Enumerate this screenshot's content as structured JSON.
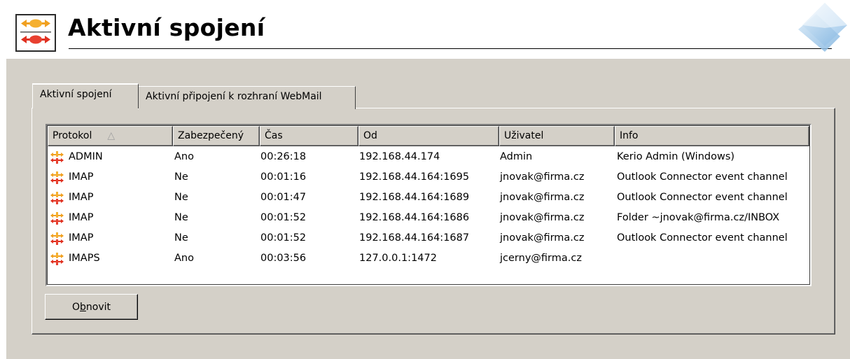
{
  "header": {
    "title": "Aktivní spojení",
    "icon": "connections-icon"
  },
  "tabs": [
    {
      "label": "Aktivní spojení",
      "active": true
    },
    {
      "label": "Aktivní připojení k rozhraní WebMail",
      "active": false
    }
  ],
  "table": {
    "columns": [
      "Protokol",
      "Zabezpečený",
      "Čas",
      "Od",
      "Uživatel",
      "Info"
    ],
    "sort": {
      "column": "Protokol",
      "direction": "ascending"
    },
    "rows": [
      [
        "ADMIN",
        "Ano",
        "00:26:18",
        "192.168.44.174",
        "Admin",
        "Kerio Admin (Windows)"
      ],
      [
        "IMAP",
        "Ne",
        "00:01:16",
        "192.168.44.164:1695",
        "jnovak@firma.cz",
        "Outlook Connector event channel"
      ],
      [
        "IMAP",
        "Ne",
        "00:01:47",
        "192.168.44.164:1689",
        "jnovak@firma.cz",
        "Outlook Connector event channel"
      ],
      [
        "IMAP",
        "Ne",
        "00:01:52",
        "192.168.44.164:1686",
        "jnovak@firma.cz",
        "Folder ~jnovak@firma.cz/INBOX"
      ],
      [
        "IMAP",
        "Ne",
        "00:01:52",
        "192.168.44.164:1687",
        "jnovak@firma.cz",
        "Outlook Connector event channel"
      ],
      [
        "IMAPS",
        "Ano",
        "00:03:56",
        "127.0.0.1:1472",
        "jcerny@firma.cz",
        ""
      ]
    ]
  },
  "buttons": {
    "refresh_prefix": "O",
    "refresh_underlined": "b",
    "refresh_suffix": "novit"
  },
  "colors": {
    "background": "#d4d0c8",
    "icon_orange": "#f0a020",
    "icon_red": "#e03020"
  }
}
